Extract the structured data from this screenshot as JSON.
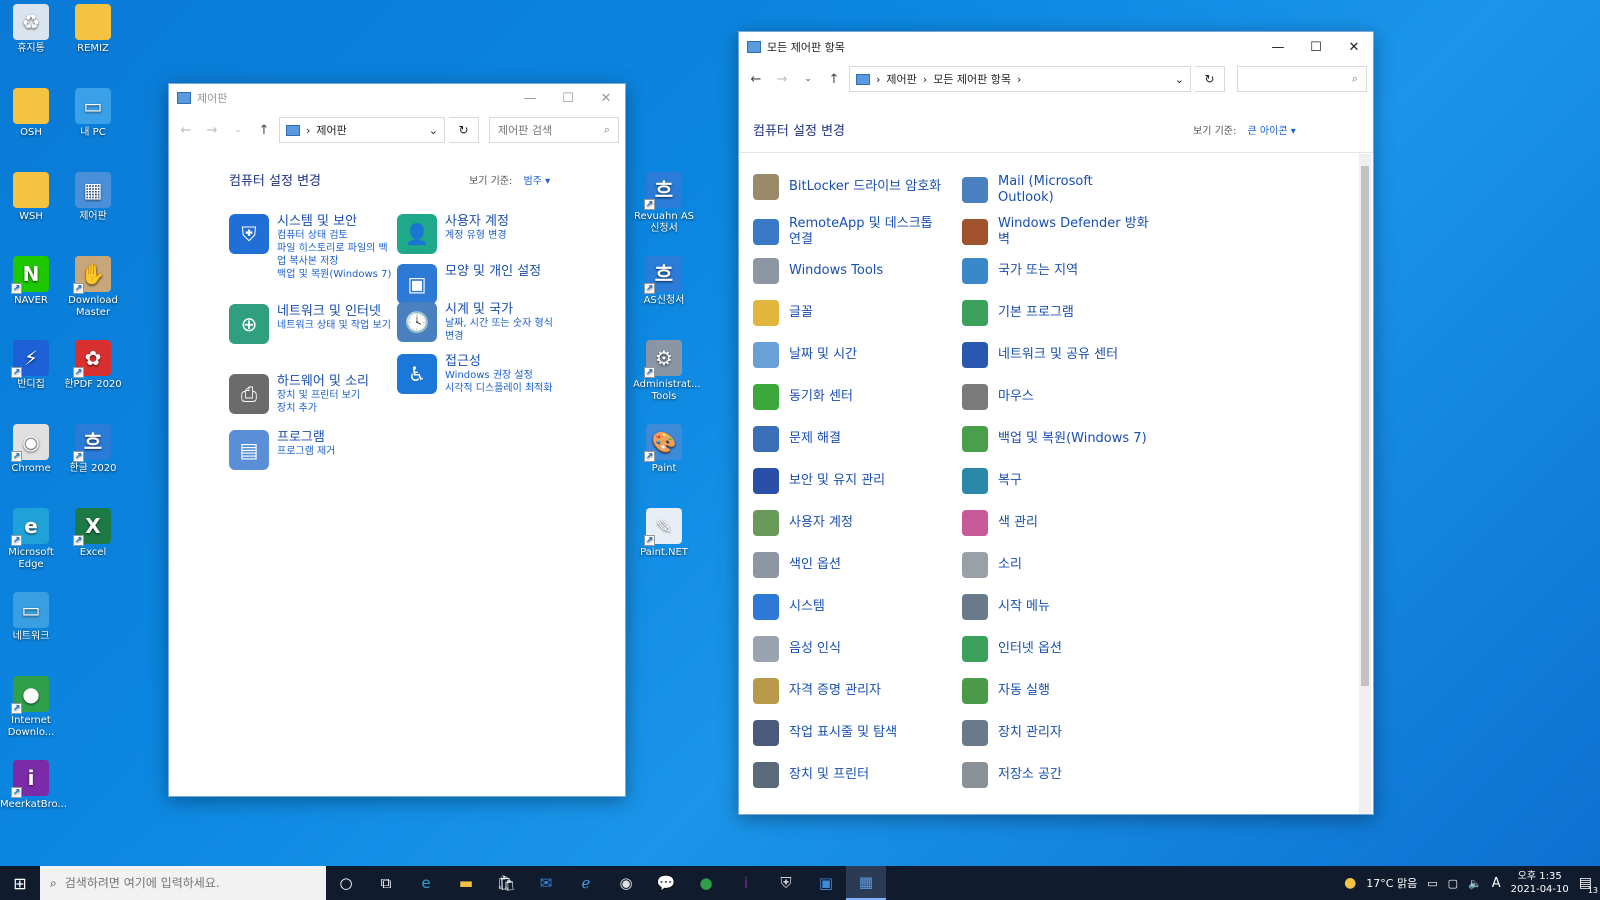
{
  "desktop": {
    "icons": [
      {
        "label": "휴지통",
        "color": "#d9e4ee",
        "glyph": "♻",
        "shortcut": false
      },
      {
        "label": "REMIZ",
        "color": "#f5c342",
        "glyph": "",
        "shortcut": false
      },
      {
        "label": "OSH",
        "color": "#f5c342",
        "glyph": "",
        "shortcut": false
      },
      {
        "label": "내 PC",
        "color": "#3aa0e8",
        "glyph": "▭",
        "shortcut": false
      },
      {
        "label": "WSH",
        "color": "#f5c342",
        "glyph": "",
        "shortcut": false
      },
      {
        "label": "제어판",
        "color": "#4a90d9",
        "glyph": "▦",
        "shortcut": false
      },
      {
        "label": "NAVER",
        "color": "#1ec800",
        "glyph": "N",
        "shortcut": true
      },
      {
        "label": "Download Master",
        "color": "#c7a77a",
        "glyph": "✋",
        "shortcut": true
      },
      {
        "label": "반디집",
        "color": "#1c5fd6",
        "glyph": "⚡",
        "shortcut": true
      },
      {
        "label": "한PDF 2020",
        "color": "#d8302f",
        "glyph": "✿",
        "shortcut": true
      },
      {
        "label": "Chrome",
        "color": "#e0e0e0",
        "glyph": "◉",
        "shortcut": true
      },
      {
        "label": "한글 2020",
        "color": "#2b7bd8",
        "glyph": "흐",
        "shortcut": true
      },
      {
        "label": "Microsoft Edge",
        "color": "#1fa2d8",
        "glyph": "e",
        "shortcut": true
      },
      {
        "label": "Excel",
        "color": "#1d7a45",
        "glyph": "X",
        "shortcut": true
      },
      {
        "label": "네트워크",
        "color": "#3a9fe0",
        "glyph": "▭",
        "shortcut": false
      },
      {
        "label": "Internet Downlo...",
        "color": "#2f9f4a",
        "glyph": "●",
        "shortcut": true
      },
      {
        "label": "MeerkatBro...",
        "color": "#7b2aa8",
        "glyph": "i",
        "shortcut": true
      },
      {
        "label": "Revuahn AS신청서",
        "color": "#2b7bd8",
        "glyph": "흐",
        "shortcut": true
      },
      {
        "label": "AS신청서",
        "color": "#2b7bd8",
        "glyph": "흐",
        "shortcut": true
      },
      {
        "label": "Administrat... Tools",
        "color": "#8a96a6",
        "glyph": "⚙",
        "shortcut": true
      },
      {
        "label": "Paint",
        "color": "#3d8ad9",
        "glyph": "🎨",
        "shortcut": true
      },
      {
        "label": "Paint.NET",
        "color": "#e8eef5",
        "glyph": "✎",
        "shortcut": true
      }
    ]
  },
  "cp_window": {
    "title": "제어판",
    "address": "제어판",
    "search_placeholder": "제어판 검색",
    "heading": "컴퓨터 설정 변경",
    "viewby_label": "보기 기준:",
    "viewby_value": "범주 ▾",
    "categories": [
      {
        "title": "시스템 및 보안",
        "color": "#1f6fd6",
        "glyph": "⛨",
        "subs": [
          "컴퓨터 상태 검토",
          "파일 히스토리로 파일의 백업 복사본 저장",
          "백업 및 복원(Windows 7)"
        ]
      },
      {
        "title": "네트워크 및 인터넷",
        "color": "#2f9f80",
        "glyph": "⊕",
        "subs": [
          "네트워크 상태 및 작업 보기"
        ]
      },
      {
        "title": "하드웨어 및 소리",
        "color": "#6b6b6b",
        "glyph": "⎙",
        "subs": [
          "장치 및 프린터 보기",
          "장치 추가"
        ]
      },
      {
        "title": "프로그램",
        "color": "#5a8ed6",
        "glyph": "▤",
        "subs": [
          "프로그램 제거"
        ]
      },
      {
        "title": "사용자 계정",
        "color": "#1fa88a",
        "glyph": "👤",
        "subs": [
          "계정 유형 변경"
        ]
      },
      {
        "title": "모양 및 개인 설정",
        "color": "#2c7ad6",
        "glyph": "▣",
        "subs": []
      },
      {
        "title": "시계 및 국가",
        "color": "#4a7fc0",
        "glyph": "🕓",
        "subs": [
          "날짜, 시간 또는 숫자 형식 변경"
        ]
      },
      {
        "title": "접근성",
        "color": "#1c78d8",
        "glyph": "♿",
        "subs": [
          "Windows 권장 설정",
          "시각적 디스플레이 최적화"
        ]
      }
    ]
  },
  "all_window": {
    "title": "모든 제어판 항목",
    "address_1": "제어판",
    "address_2": "모든 제어판 항목",
    "heading": "컴퓨터 설정 변경",
    "viewby_label": "보기 기준:",
    "viewby_value": "큰 아이콘 ▾",
    "items_left": [
      {
        "label": "BitLocker 드라이브 암호화",
        "color": "#9a8a6a"
      },
      {
        "label": "RemoteApp 및 데스크톱 연결",
        "color": "#3a78c8"
      },
      {
        "label": "Windows Tools",
        "color": "#8d97a4"
      },
      {
        "label": "글꼴",
        "color": "#e3b53c"
      },
      {
        "label": "날짜 및 시간",
        "color": "#6aa0d8"
      },
      {
        "label": "동기화 센터",
        "color": "#3aa83a"
      },
      {
        "label": "문제 해결",
        "color": "#3a6fb8"
      },
      {
        "label": "보안 및 유지 관리",
        "color": "#2a4fa8"
      },
      {
        "label": "사용자 계정",
        "color": "#6a9a5a"
      },
      {
        "label": "색인 옵션",
        "color": "#8d97a4"
      },
      {
        "label": "시스템",
        "color": "#2c7ad6"
      },
      {
        "label": "음성 인식",
        "color": "#9aa4b0"
      },
      {
        "label": "자격 증명 관리자",
        "color": "#b89a4a"
      },
      {
        "label": "작업 표시줄 및 탐색",
        "color": "#4a5a7a"
      },
      {
        "label": "장치 및 프린터",
        "color": "#5a6a7a"
      }
    ],
    "items_right": [
      {
        "label": "Mail (Microsoft Outlook)",
        "color": "#4a7fc0"
      },
      {
        "label": "Windows Defender 방화벽",
        "color": "#a0522d"
      },
      {
        "label": "국가 또는 지역",
        "color": "#3a88c8"
      },
      {
        "label": "기본 프로그램",
        "color": "#3aa05a"
      },
      {
        "label": "네트워크 및 공유 센터",
        "color": "#2a58b0"
      },
      {
        "label": "마우스",
        "color": "#7a7a7a"
      },
      {
        "label": "백업 및 복원(Windows 7)",
        "color": "#4aa04a"
      },
      {
        "label": "복구",
        "color": "#2a88a8"
      },
      {
        "label": "색 관리",
        "color": "#c85a9a"
      },
      {
        "label": "소리",
        "color": "#9aa0a8"
      },
      {
        "label": "시작 메뉴",
        "color": "#6a7a8a"
      },
      {
        "label": "인터넷 옵션",
        "color": "#3aa05a"
      },
      {
        "label": "자동 실행",
        "color": "#4a9a4a"
      },
      {
        "label": "장치 관리자",
        "color": "#6a7a8a"
      },
      {
        "label": "저장소 공간",
        "color": "#8a9098"
      }
    ]
  },
  "taskbar": {
    "search_placeholder": "검색하려면 여기에 입력하세요.",
    "weather": "17°C  맑음",
    "ime": "A",
    "time": "오후 1:35",
    "date": "2021-04-10",
    "notifications": "13",
    "apps": [
      {
        "name": "cortana",
        "color": "#ffffff",
        "glyph": "○"
      },
      {
        "name": "task-view",
        "color": "#ffffff",
        "glyph": "⧉"
      },
      {
        "name": "edge",
        "color": "#1fa2d8",
        "glyph": "e"
      },
      {
        "name": "explorer",
        "color": "#f5c342",
        "glyph": "▬"
      },
      {
        "name": "store",
        "color": "#ffffff",
        "glyph": "🛍"
      },
      {
        "name": "mail",
        "color": "#3a8ae0",
        "glyph": "✉"
      },
      {
        "name": "ie",
        "color": "#3aa0e8",
        "glyph": "ℯ"
      },
      {
        "name": "chrome",
        "color": "#e0e0e0",
        "glyph": "◉"
      },
      {
        "name": "kakaotalk",
        "color": "#f5dc00",
        "glyph": "💬"
      },
      {
        "name": "idm",
        "color": "#2f9f4a",
        "glyph": "●"
      },
      {
        "name": "meerkat",
        "color": "#7b2aa8",
        "glyph": "i"
      },
      {
        "name": "shield",
        "color": "#d0d0d0",
        "glyph": "⛨"
      },
      {
        "name": "photos",
        "color": "#3d8ad9",
        "glyph": "▣"
      },
      {
        "name": "control-panel",
        "color": "#5a9be0",
        "glyph": "▦"
      }
    ]
  }
}
